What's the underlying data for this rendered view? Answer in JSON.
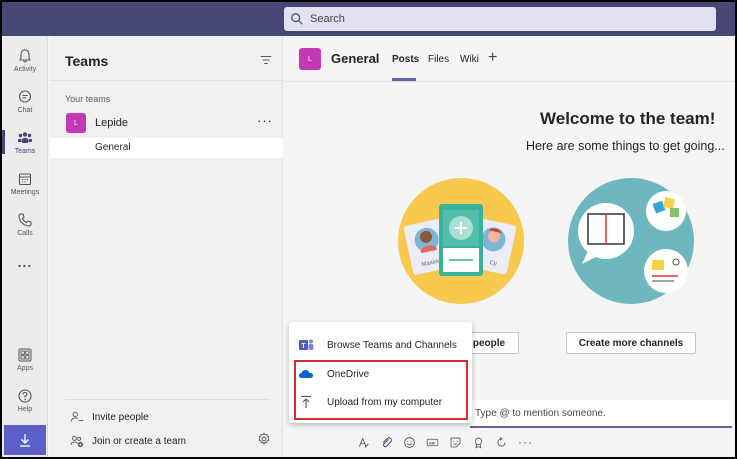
{
  "search": {
    "placeholder": "Search"
  },
  "rail": {
    "items": [
      {
        "label": "Activity",
        "icon": "bell-icon"
      },
      {
        "label": "Chat",
        "icon": "chat-icon"
      },
      {
        "label": "Teams",
        "icon": "teams-icon"
      },
      {
        "label": "Meetings",
        "icon": "calendar-icon"
      },
      {
        "label": "Calls",
        "icon": "phone-icon"
      }
    ],
    "more": "...",
    "apps_label": "Apps",
    "help_label": "Help"
  },
  "panel": {
    "title": "Teams",
    "section_label": "Your teams",
    "team": {
      "name": "Lepide",
      "avatar_initial": "L"
    },
    "channel": "General",
    "footer": {
      "invite": "Invite people",
      "join": "Join or create a team"
    }
  },
  "channel_header": {
    "avatar_initial": "L",
    "title": "General",
    "tabs": [
      "Posts",
      "Files",
      "Wiki"
    ]
  },
  "welcome": {
    "title": "Welcome to the team!",
    "subtitle": "Here are some things to get going...",
    "card_names": [
      "Maxine",
      "Cy"
    ],
    "buttons": {
      "add_people": "people",
      "create_channels": "Create more channels"
    }
  },
  "popup": {
    "items": [
      {
        "label": "Browse Teams and Channels",
        "icon": "teams-logo-icon"
      },
      {
        "label": "OneDrive",
        "icon": "onedrive-icon"
      },
      {
        "label": "Upload from my computer",
        "icon": "upload-icon"
      }
    ]
  },
  "compose": {
    "placeholder": "Type @ to mention someone."
  },
  "colors": {
    "topbar": "#464775",
    "accent": "#6264a7",
    "team_avatar": "#c239b3",
    "highlight": "#d32f2f"
  }
}
